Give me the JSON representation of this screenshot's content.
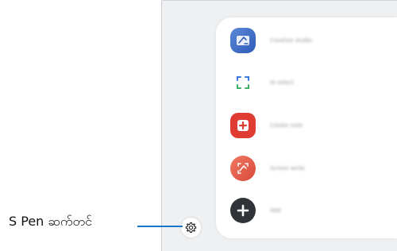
{
  "callout": {
    "label": "S Pen ဆက်တင်"
  },
  "air_command": {
    "items": [
      {
        "label": "Creative studio",
        "icon": "creative-studio-icon"
      },
      {
        "label": "AI select",
        "icon": "ai-select-icon"
      },
      {
        "label": "Create note",
        "icon": "create-note-icon"
      },
      {
        "label": "Screen write",
        "icon": "screen-write-icon"
      },
      {
        "label": "Add",
        "icon": "add-icon"
      }
    ],
    "settings_icon": "settings-gear-icon"
  },
  "colors": {
    "callout_line": "#1976c8",
    "create_note": "#e03b33",
    "screen_write": "#e5604c",
    "creative_studio": "#3f6fc9",
    "add": "#303438"
  }
}
